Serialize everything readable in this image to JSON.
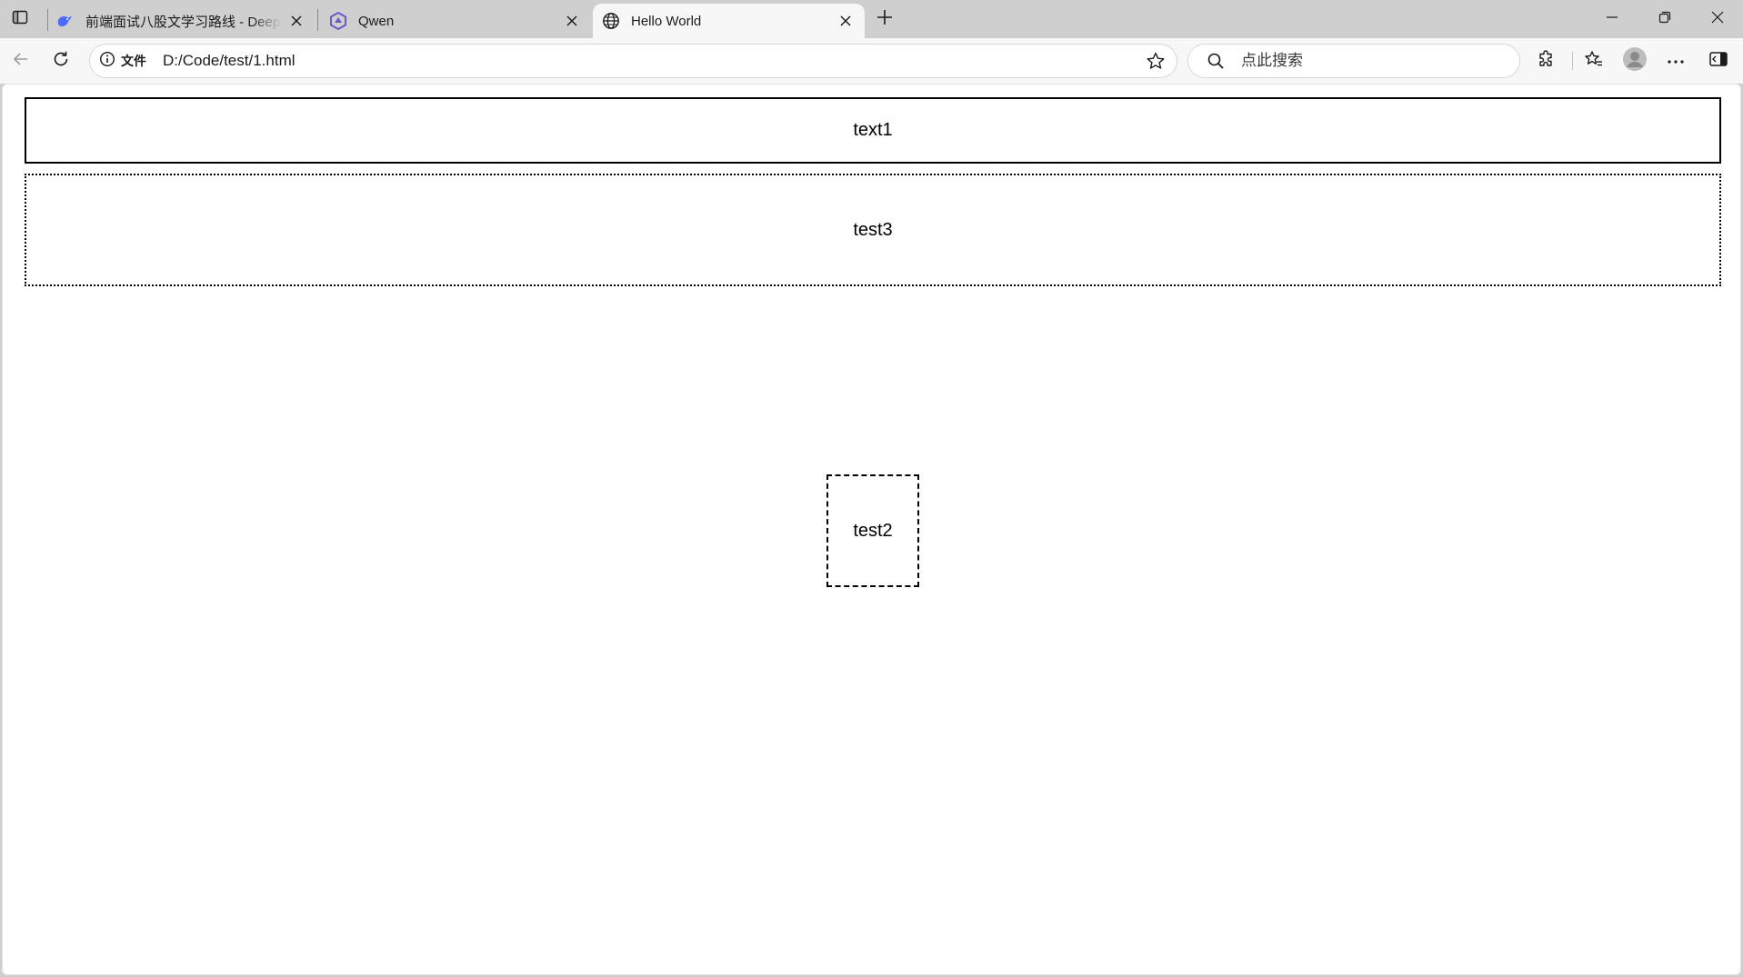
{
  "browser": {
    "tabs": [
      {
        "title": "前端面试八股文学习路线 - DeepSeek",
        "favicon": "deepseek-whale-icon",
        "active": false
      },
      {
        "title": "Qwen",
        "favicon": "qwen-logo-icon",
        "active": false
      },
      {
        "title": "Hello World",
        "favicon": "globe-icon",
        "active": true
      }
    ],
    "address": {
      "security_label": "文件",
      "url": "D:/Code/test/1.html"
    },
    "search": {
      "placeholder": "点此搜索"
    },
    "colors": {
      "tabstrip": "#cfcfcf",
      "toolbar": "#f7f7f7",
      "page_background": "#ffffff",
      "qwen_accent": "#6a5acd",
      "deepseek_accent": "#4d6bfe"
    }
  },
  "page": {
    "boxes": [
      {
        "text": "text1",
        "border": "solid"
      },
      {
        "text": "test3",
        "border": "dotted"
      },
      {
        "text": "test2",
        "border": "dashed"
      }
    ]
  }
}
